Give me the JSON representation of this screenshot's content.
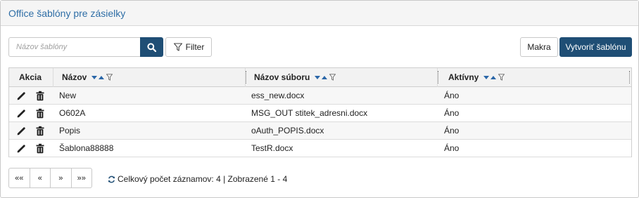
{
  "panel": {
    "title": "Office šablóny pre zásielky"
  },
  "toolbar": {
    "search_placeholder": "Názov šablóny",
    "search_value": "",
    "filter_label": "Filter",
    "macros_label": "Makra",
    "create_label": "Vytvoriť šablónu"
  },
  "grid": {
    "columns": {
      "actions": "Akcia",
      "name": "Názov",
      "file": "Názov súboru",
      "active": "Aktívny"
    },
    "rows": [
      {
        "name": "New",
        "file": "ess_new.docx",
        "active": "Áno"
      },
      {
        "name": "O602A",
        "file": "MSG_OUT stitek_adresni.docx",
        "active": "Áno"
      },
      {
        "name": "Popis",
        "file": "oAuth_POPIS.docx",
        "active": "Áno"
      },
      {
        "name": "Šablona88888",
        "file": "TestR.docx",
        "active": "Áno"
      }
    ]
  },
  "pager": {
    "first": "««",
    "prev": "«",
    "next": "»",
    "last": "»»"
  },
  "summary": {
    "text": "Celkový počet záznamov: 4 | Zobrazené 1 - 4"
  },
  "colors": {
    "title": "#2f6ea6",
    "primary": "#1f4e75",
    "sort_arrow": "#2a66a8"
  },
  "icons": [
    "search-icon",
    "filter-icon",
    "sort-arrows-icon",
    "column-filter-icon",
    "edit-icon",
    "delete-icon",
    "refresh-icon"
  ]
}
